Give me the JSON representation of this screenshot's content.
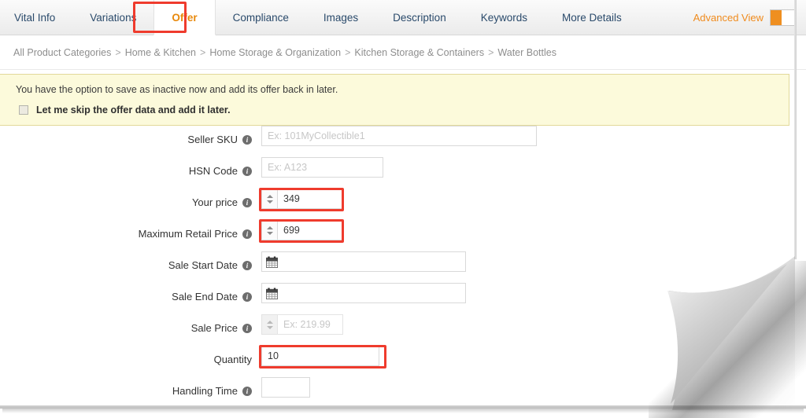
{
  "tabs": [
    {
      "label": "Vital Info",
      "active": false
    },
    {
      "label": "Variations",
      "active": false
    },
    {
      "label": "Offer",
      "active": true
    },
    {
      "label": "Compliance",
      "active": false
    },
    {
      "label": "Images",
      "active": false
    },
    {
      "label": "Description",
      "active": false
    },
    {
      "label": "Keywords",
      "active": false
    },
    {
      "label": "More Details",
      "active": false
    }
  ],
  "header": {
    "advanced_view_label": "Advanced View",
    "advanced_view_state": "on"
  },
  "breadcrumb": {
    "separator": ">",
    "items": [
      "All Product Categories",
      "Home & Kitchen",
      "Home Storage & Organization",
      "Kitchen Storage & Containers",
      "Water Bottles"
    ]
  },
  "notice": {
    "message": "You have the option to save as inactive now and add its offer back in later.",
    "checkbox_label": "Let me skip the offer data and add it later.",
    "checkbox_checked": false
  },
  "form": {
    "fields": [
      {
        "name": "seller-sku",
        "label": "Seller SKU",
        "info": true,
        "type": "text",
        "value": "",
        "placeholder": "Ex: 101MyCollectible1",
        "width_class": "w-sku",
        "highlighted": false,
        "disabled": false
      },
      {
        "name": "hsn-code",
        "label": "HSN Code",
        "info": true,
        "type": "text",
        "value": "",
        "placeholder": "Ex: A123",
        "width_class": "w-hsn",
        "highlighted": false,
        "disabled": false
      },
      {
        "name": "your-price",
        "label": "Your price",
        "info": true,
        "type": "stepper",
        "value": "349",
        "placeholder": "",
        "width_class": "w-num",
        "highlighted": true,
        "disabled": false
      },
      {
        "name": "maximum-retail-price",
        "label": "Maximum Retail Price",
        "info": true,
        "type": "stepper",
        "value": "699",
        "placeholder": "",
        "width_class": "w-num",
        "highlighted": true,
        "disabled": false
      },
      {
        "name": "sale-start-date",
        "label": "Sale Start Date",
        "info": true,
        "type": "date",
        "value": "",
        "placeholder": "",
        "width_class": "w-date",
        "highlighted": false,
        "disabled": false
      },
      {
        "name": "sale-end-date",
        "label": "Sale End Date",
        "info": true,
        "type": "date",
        "value": "",
        "placeholder": "",
        "width_class": "w-date",
        "highlighted": false,
        "disabled": false
      },
      {
        "name": "sale-price",
        "label": "Sale Price",
        "info": true,
        "type": "stepper",
        "value": "",
        "placeholder": "Ex: 219.99",
        "width_class": "w-sale",
        "highlighted": false,
        "disabled": true
      },
      {
        "name": "quantity",
        "label": "Quantity",
        "info": false,
        "type": "text",
        "value": "10",
        "placeholder": "",
        "width_class": "w-qty",
        "highlighted": true,
        "disabled": false
      },
      {
        "name": "handling-time",
        "label": "Handling Time",
        "info": true,
        "type": "text",
        "value": "",
        "placeholder": "",
        "width_class": "w-hand",
        "highlighted": false,
        "disabled": false
      }
    ]
  },
  "colors": {
    "annotation": "#ef3b2d",
    "accent_orange": "#ef8f20",
    "active_tab_text": "#e8890c",
    "tab_text": "#2a4a6b",
    "notice_bg": "#fcfadb",
    "notice_border": "#e2d99a"
  }
}
